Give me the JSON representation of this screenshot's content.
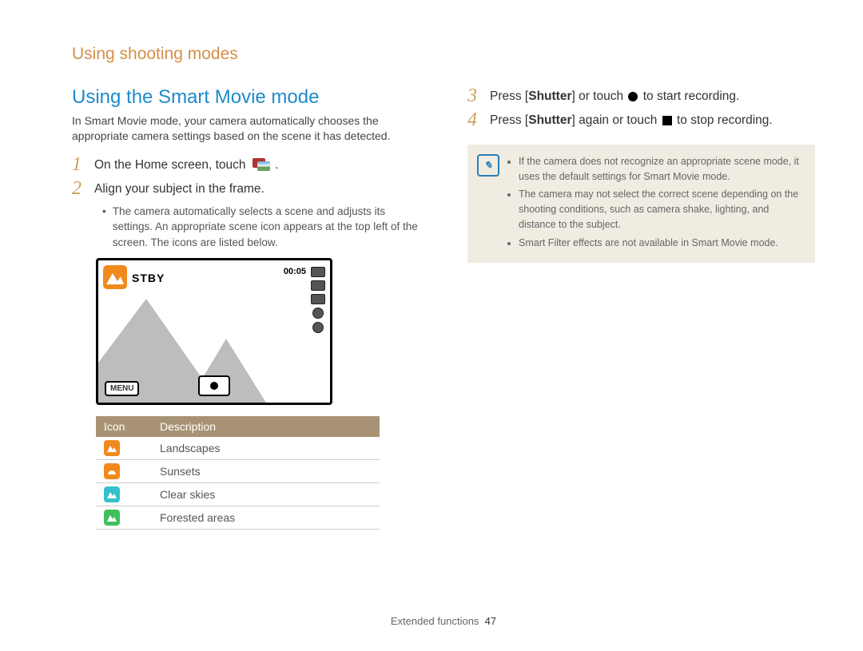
{
  "header": {
    "section": "Using shooting modes"
  },
  "left": {
    "heading": "Using the Smart Movie mode",
    "intro": "In Smart Movie mode, your camera automatically chooses the appropriate camera settings based on the scene it has detected.",
    "step1_prefix": "On the Home screen, touch ",
    "step1_suffix": ".",
    "step2": "Align your subject in the frame.",
    "step2_note": "The camera automatically selects a scene and adjusts its settings. An appropriate scene icon appears at the top left of the screen. The icons are listed below.",
    "screen": {
      "stby": "STBY",
      "timer": "00:05",
      "menu": "MENU"
    },
    "table": {
      "head_icon": "Icon",
      "head_desc": "Description",
      "rows": [
        {
          "desc": "Landscapes"
        },
        {
          "desc": "Sunsets"
        },
        {
          "desc": "Clear skies"
        },
        {
          "desc": "Forested areas"
        }
      ]
    }
  },
  "right": {
    "step3_a": "Press [",
    "step3_b": "Shutter",
    "step3_c": "] or touch ",
    "step3_d": " to start recording.",
    "step4_a": "Press [",
    "step4_b": "Shutter",
    "step4_c": "] again or touch ",
    "step4_d": " to stop recording.",
    "notes": [
      "If the camera does not recognize an appropriate scene mode, it uses the default settings for Smart Movie mode.",
      "The camera may not select the correct scene depending on the shooting conditions, such as camera shake, lighting, and distance to the subject.",
      "Smart Filter effects are not available in Smart Movie mode."
    ]
  },
  "footer": {
    "label": "Extended functions",
    "page": "47"
  },
  "nums": {
    "n1": "1",
    "n2": "2",
    "n3": "3",
    "n4": "4"
  }
}
